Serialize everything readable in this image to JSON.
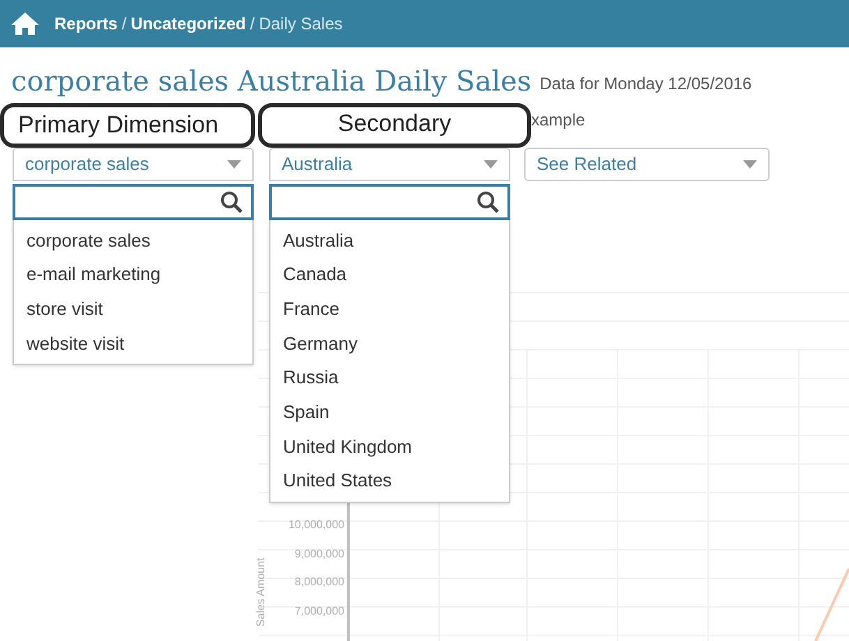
{
  "breadcrumb": [
    {
      "label": "Reports",
      "current": false
    },
    {
      "label": "Uncategorized",
      "current": false
    },
    {
      "label": "Daily Sales",
      "current": true
    }
  ],
  "page_title": "corporate sales Australia Daily Sales",
  "data_date": "Data for Monday 12/05/2016",
  "callouts": [
    "Primary Dimension",
    "Secondary"
  ],
  "behind_text": "xample",
  "dropdowns": [
    {
      "value": "corporate sales",
      "expanded": true,
      "options": [
        "corporate sales",
        "e-mail marketing",
        "store visit",
        "website visit"
      ]
    },
    {
      "value": "Australia",
      "expanded": true,
      "options": [
        "Australia",
        "Canada",
        "France",
        "Germany",
        "Russia",
        "Spain",
        "United Kingdom",
        "United States"
      ]
    },
    {
      "value": "See Related",
      "expanded": false
    }
  ],
  "breadcrumb_separator": "/",
  "chart": {
    "ylabel": "Sales Amount",
    "yticks": [
      "10,000,000",
      "9,000,000",
      "8,000,000",
      "7,000,000"
    ]
  }
}
